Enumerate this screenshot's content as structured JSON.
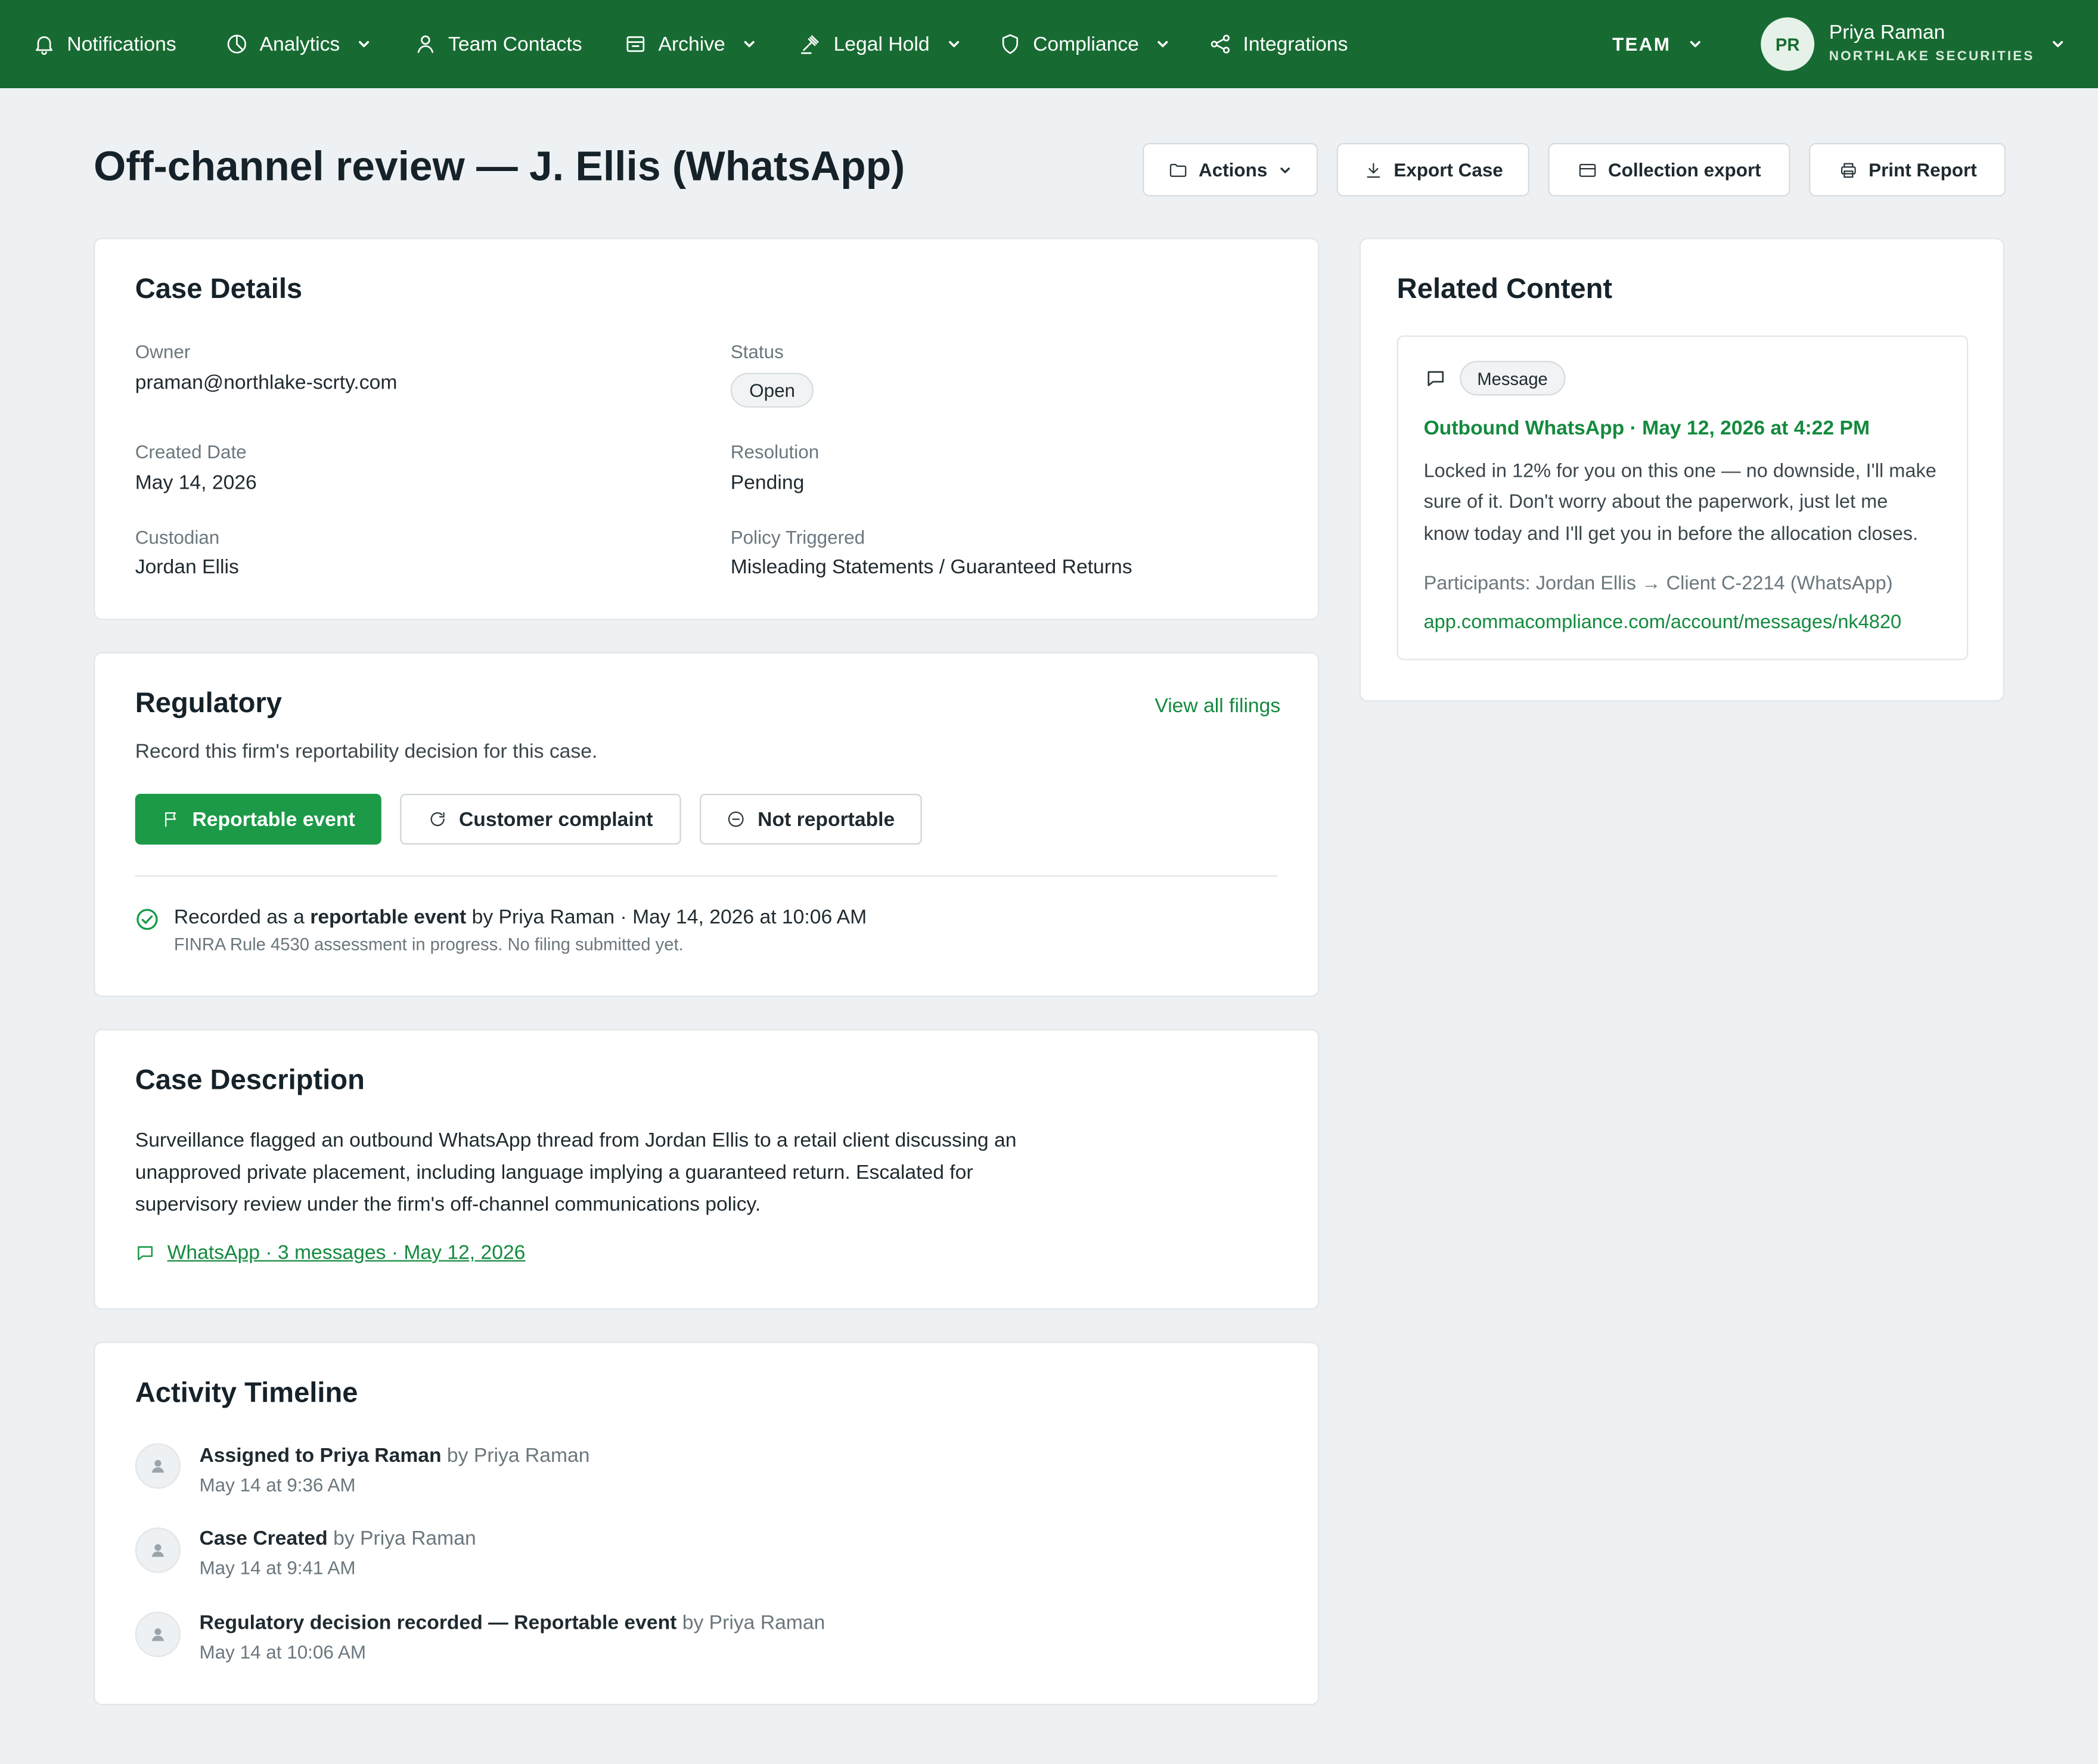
{
  "nav": {
    "notifications": "Notifications",
    "analytics": "Analytics",
    "team_contacts": "Team Contacts",
    "archive": "Archive",
    "legal_hold": "Legal Hold",
    "compliance": "Compliance",
    "integrations": "Integrations",
    "team": "TEAM",
    "user_initials": "PR",
    "user_name": "Priya Raman",
    "user_org": "NORTHLAKE SECURITIES"
  },
  "header": {
    "title": "Off-channel review — J. Ellis (WhatsApp)",
    "actions_label": "Actions",
    "export_case_label": "Export Case",
    "collection_export_label": "Collection export",
    "print_report_label": "Print Report"
  },
  "case_details": {
    "title": "Case Details",
    "owner_label": "Owner",
    "owner_value": "praman@northlake-scrty.com",
    "status_label": "Status",
    "status_value": "Open",
    "created_label": "Created Date",
    "created_value": "May 14, 2026",
    "resolution_label": "Resolution",
    "resolution_value": "Pending",
    "custodian_label": "Custodian",
    "custodian_value": "Jordan Ellis",
    "policy_label": "Policy Triggered",
    "policy_value": "Misleading Statements / Guaranteed Returns"
  },
  "regulatory": {
    "title": "Regulatory",
    "view_all": "View all filings",
    "subtitle": "Record this firm's reportability decision for this case.",
    "btn_reportable": "Reportable event",
    "btn_complaint": "Customer complaint",
    "btn_not_reportable": "Not reportable",
    "recorded_prefix": "Recorded as a",
    "recorded_bold": "reportable event",
    "recorded_suffix": "by Priya Raman · May 14, 2026 at 10:06 AM",
    "recorded_note": "FINRA Rule 4530 assessment in progress. No filing submitted yet."
  },
  "description": {
    "title": "Case Description",
    "line1": "Surveillance flagged an outbound WhatsApp thread from Jordan Ellis to a retail client discussing an",
    "line2": "unapproved private placement, including language implying a guaranteed return. Escalated for",
    "line3": "supervisory review under the firm's off-channel communications policy.",
    "link": "WhatsApp · 3 messages · May 12, 2026"
  },
  "timeline": {
    "title": "Activity Timeline",
    "items": [
      {
        "bold": "Assigned to Priya Raman",
        "by": "by Priya Raman",
        "time": "May 14 at 9:36 AM"
      },
      {
        "bold": "Case Created",
        "by": "by Priya Raman",
        "time": "May 14 at 9:41 AM"
      },
      {
        "bold": "Regulatory decision recorded — Reportable event",
        "by": "by Priya Raman",
        "time": "May 14 at 10:06 AM"
      }
    ]
  },
  "related": {
    "title": "Related Content",
    "tag": "Message",
    "heading": "Outbound WhatsApp · May 12, 2026 at 4:22 PM",
    "body1": "Locked in 12% for you on this one — no downside, I'll make",
    "body2": "sure of it. Don't worry about the paperwork, just let me",
    "body3": "know today and I'll get you in before the allocation closes.",
    "participants": "Participants: Jordan Ellis → Client C-2214 (WhatsApp)",
    "url": "app.commacompliance.com/account/messages/nk4820"
  },
  "colors": {
    "nav_bg": "#176b32",
    "accent": "#1c9a48",
    "link": "#138a3e",
    "page_bg": "#eef1f3"
  }
}
